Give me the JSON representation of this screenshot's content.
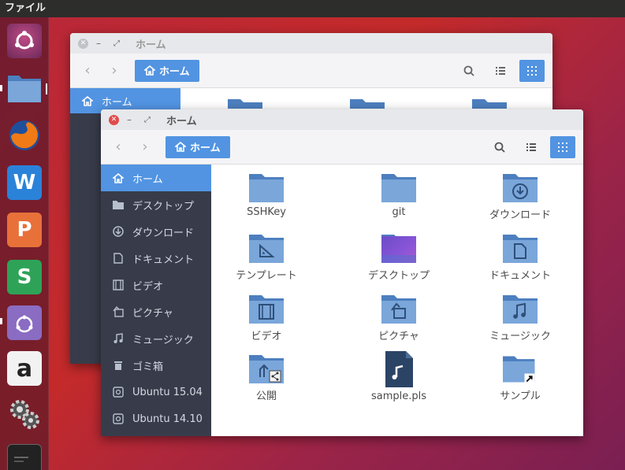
{
  "top_panel": {
    "menu_label": "ファイル"
  },
  "colors": {
    "accent": "#5294e2",
    "sidebar_bg": "#383c4a",
    "folder": "#6e9ccc",
    "close_red": "#e14b4b"
  },
  "launcher": {
    "items": [
      {
        "name": "ubuntu-dash",
        "label": ""
      },
      {
        "name": "files",
        "label": ""
      },
      {
        "name": "firefox",
        "label": ""
      },
      {
        "name": "writer",
        "label": "W"
      },
      {
        "name": "impress",
        "label": "P"
      },
      {
        "name": "calc",
        "label": "S"
      },
      {
        "name": "software-center",
        "label": ""
      },
      {
        "name": "amazon",
        "label": "a"
      },
      {
        "name": "system-settings",
        "label": ""
      },
      {
        "name": "terminal",
        "label": ""
      }
    ]
  },
  "back_window": {
    "title": "ホーム",
    "path_label": "ホーム",
    "sidebar_active": "ホーム"
  },
  "front_window": {
    "title": "ホーム",
    "path_label": "ホーム",
    "sidebar": [
      {
        "label": "ホーム",
        "icon": "home-icon",
        "active": true
      },
      {
        "label": "デスクトップ",
        "icon": "folder-icon",
        "active": false
      },
      {
        "label": "ダウンロード",
        "icon": "download-icon",
        "active": false
      },
      {
        "label": "ドキュメント",
        "icon": "document-icon",
        "active": false
      },
      {
        "label": "ビデオ",
        "icon": "video-icon",
        "active": false
      },
      {
        "label": "ピクチャ",
        "icon": "picture-icon",
        "active": false
      },
      {
        "label": "ミュージック",
        "icon": "music-icon",
        "active": false
      },
      {
        "label": "ゴミ箱",
        "icon": "trash-icon",
        "active": false
      },
      {
        "label": "Ubuntu 15.04",
        "icon": "drive-icon",
        "active": false
      },
      {
        "label": "Ubuntu 14.10",
        "icon": "drive-icon",
        "active": false
      }
    ],
    "files": [
      {
        "label": "SSHKey",
        "icon": "folder"
      },
      {
        "label": "git",
        "icon": "folder"
      },
      {
        "label": "ダウンロード",
        "icon": "folder-download"
      },
      {
        "label": "テンプレート",
        "icon": "folder-templates"
      },
      {
        "label": "デスクトップ",
        "icon": "folder-desktop"
      },
      {
        "label": "ドキュメント",
        "icon": "folder-documents"
      },
      {
        "label": "ビデオ",
        "icon": "folder-video"
      },
      {
        "label": "ピクチャ",
        "icon": "folder-pictures"
      },
      {
        "label": "ミュージック",
        "icon": "folder-music"
      },
      {
        "label": "公開",
        "icon": "folder-public"
      },
      {
        "label": "sample.pls",
        "icon": "audio-playlist"
      },
      {
        "label": "サンプル",
        "icon": "folder-link"
      }
    ]
  }
}
